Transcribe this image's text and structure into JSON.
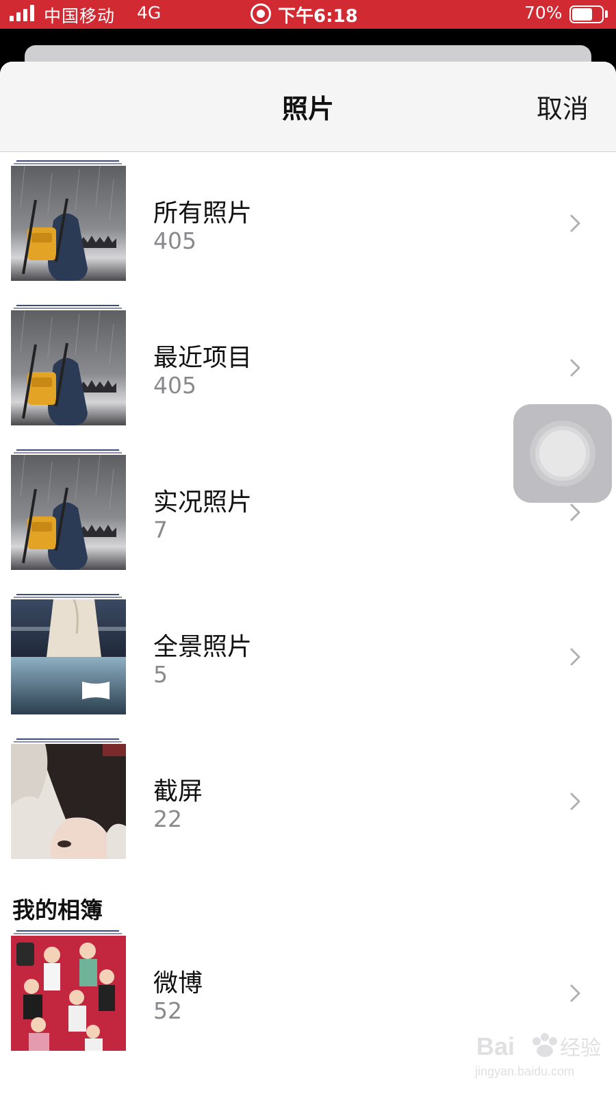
{
  "status_bar": {
    "carrier": "中国移动",
    "network": "4G",
    "time": "下午6:18",
    "battery_percent": "70%",
    "battery_level": 0.7,
    "background_color": "#d22a33"
  },
  "sheet": {
    "title": "照片",
    "cancel_label": "取消"
  },
  "albums": [
    {
      "name": "所有照片",
      "count": "405",
      "thumbnail": "backpack-figure-in-rain"
    },
    {
      "name": "最近项目",
      "count": "405",
      "thumbnail": "backpack-figure-in-rain"
    },
    {
      "name": "实况照片",
      "count": "7",
      "thumbnail": "backpack-figure-in-rain"
    },
    {
      "name": "全景照片",
      "count": "5",
      "thumbnail": "woman-in-dress-by-sea",
      "badge_icon": "panorama-icon"
    },
    {
      "name": "截屏",
      "count": "22",
      "thumbnail": "face-close-up"
    }
  ],
  "my_albums_section": {
    "header": "我的相簿",
    "albums": [
      {
        "name": "微博",
        "count": "52",
        "thumbnail": "illustrated-characters-on-red"
      }
    ]
  },
  "icons": {
    "chevron": "chevron-right-icon",
    "assistive_touch": "assistive-touch-icon"
  },
  "watermark": {
    "logo_text": "Bai经验",
    "url": "jingyan.baidu.com"
  }
}
